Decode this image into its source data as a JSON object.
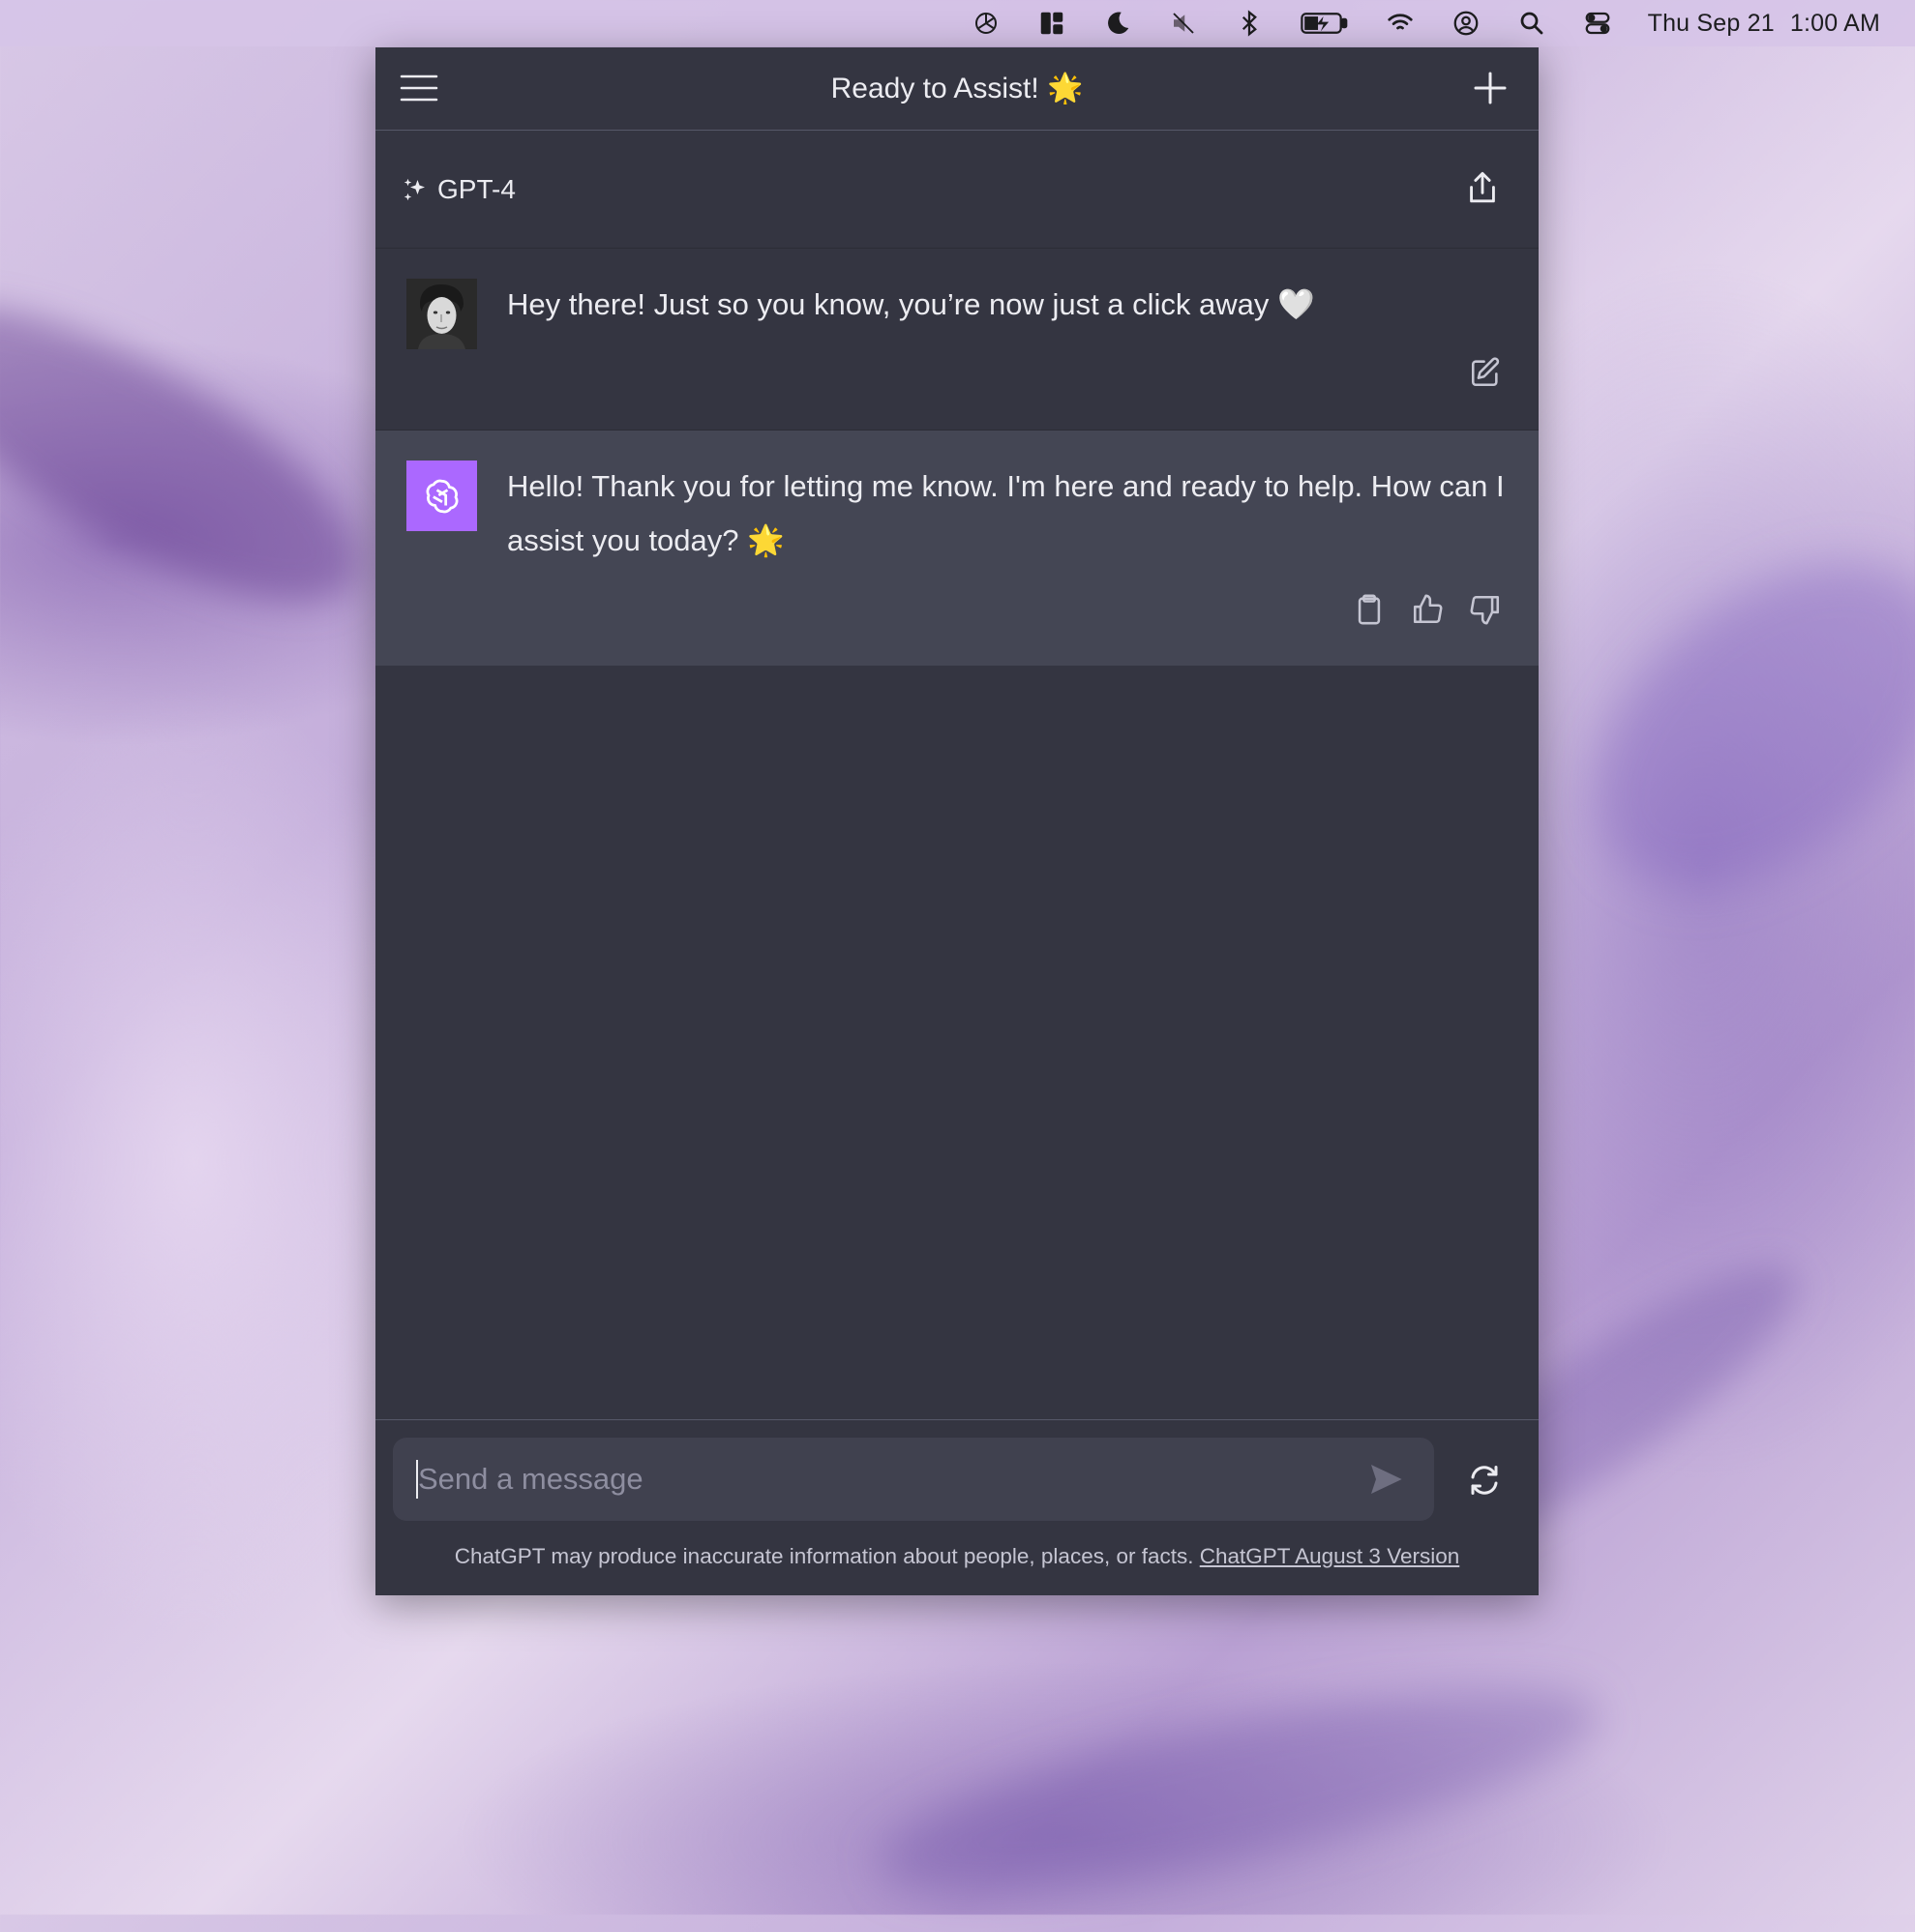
{
  "menubar": {
    "icons": [
      "openai-icon",
      "layout-icon",
      "moon-icon",
      "mute-icon",
      "bluetooth-icon",
      "battery-icon",
      "wifi-icon",
      "user-icon",
      "search-icon",
      "control-center-icon"
    ],
    "date": "Thu Sep 21",
    "time": "1:00 AM"
  },
  "window": {
    "title": "Ready to Assist! 🌟",
    "model": "GPT-4"
  },
  "messages": {
    "user_text": "Hey there! Just so you know, you’re now just a click away 🤍",
    "assistant_text": "Hello! Thank you for letting me know. I'm here and ready to help. How can I assist you today? 🌟"
  },
  "input": {
    "placeholder": "Send a message"
  },
  "footer": {
    "disclaimer": "ChatGPT may produce inaccurate information about people, places, or facts.",
    "version_link": "ChatGPT August 3 Version"
  },
  "colors": {
    "window_bg": "#343541",
    "assistant_bg": "#444654",
    "assistant_avatar": "#ab68ff",
    "input_bg": "#40414f"
  }
}
